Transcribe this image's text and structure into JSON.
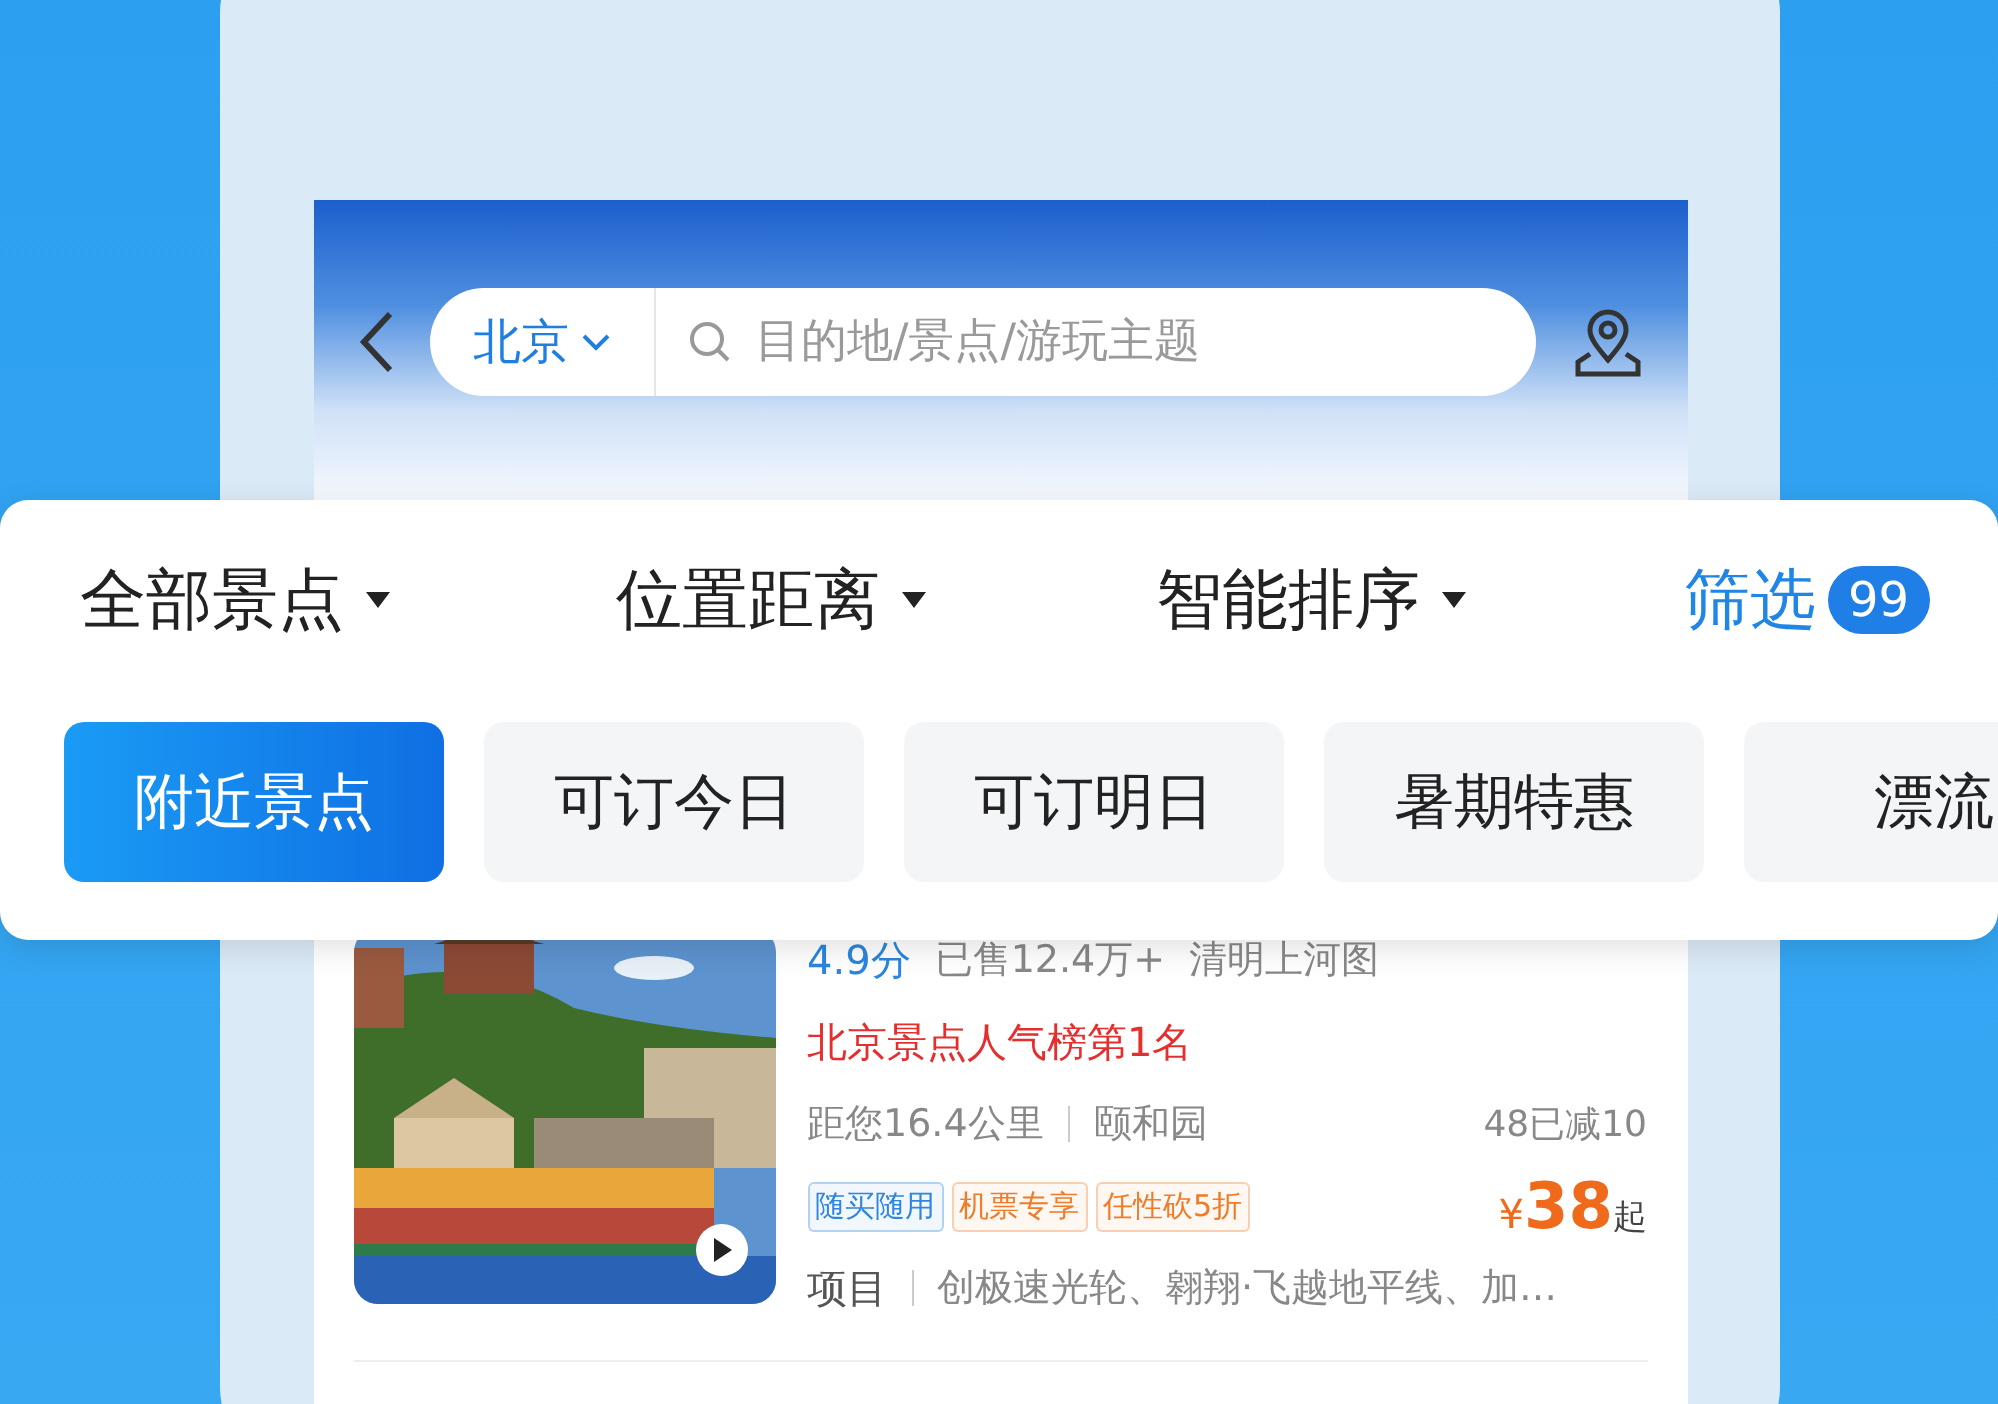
{
  "header": {
    "city": "北京",
    "search": {
      "placeholder": "目的地/景点/游玩主题"
    }
  },
  "sort_tabs": [
    {
      "label": "全部景点",
      "kind": "dropdown"
    },
    {
      "label": "位置距离",
      "kind": "dropdown"
    },
    {
      "label": "智能排序",
      "kind": "dropdown"
    },
    {
      "label": "筛选",
      "kind": "filter",
      "count": "99"
    }
  ],
  "chips": [
    {
      "label": "附近景点",
      "selected": true
    },
    {
      "label": "可订今日",
      "selected": false
    },
    {
      "label": "可订明日",
      "selected": false
    },
    {
      "label": "暑期特惠",
      "selected": false
    },
    {
      "label": "漂流",
      "selected": false
    }
  ],
  "listing": {
    "rating": "4.9分",
    "sold": "已售12.4万+",
    "highlight": "清明上河图",
    "rank": "北京景点人气榜第1名",
    "distance": "距您16.4公里",
    "name": "颐和园",
    "discount": "48已减10",
    "tags": [
      {
        "label": "随买随用",
        "color": "#2f86e0"
      },
      {
        "label": "机票专享",
        "color": "#f07c2a"
      },
      {
        "label": "任性砍5折",
        "color": "#f07c2a"
      }
    ],
    "price_symbol": "¥",
    "price": "38",
    "price_suffix": "起",
    "items_label": "项目",
    "items": "创极速光轮、翱翔·飞越地平线、加…"
  }
}
